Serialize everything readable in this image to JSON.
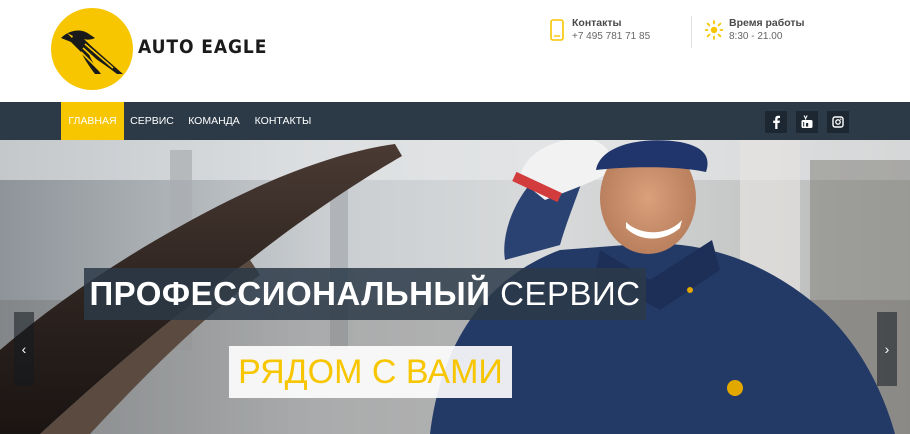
{
  "header": {
    "brand": "AUTO EAGLE",
    "contacts": {
      "title": "Контакты",
      "value": "+7 495 781 71 85",
      "icon": "phone-icon"
    },
    "hours": {
      "title": "Время работы",
      "value": "8:30 - 21.00",
      "icon": "sun-icon"
    }
  },
  "nav": {
    "items": [
      {
        "label": "ГЛАВНАЯ",
        "active": true
      },
      {
        "label": "СЕРВИС",
        "active": false
      },
      {
        "label": "КОМАНДА",
        "active": false
      },
      {
        "label": "КОНТАКТЫ",
        "active": false
      }
    ],
    "social": [
      "facebook-icon",
      "youtube-icon",
      "instagram-icon"
    ]
  },
  "hero": {
    "title_bold": "ПРОФЕССИОНАЛЬНЫЙ",
    "title_light": "СЕРВИС",
    "subtitle": "РЯДОМ С ВАМИ",
    "prev_icon": "‹",
    "next_icon": "›"
  },
  "colors": {
    "accent": "#f7c600",
    "nav_bg": "#2c3a48",
    "social_bg": "#1d2731"
  }
}
